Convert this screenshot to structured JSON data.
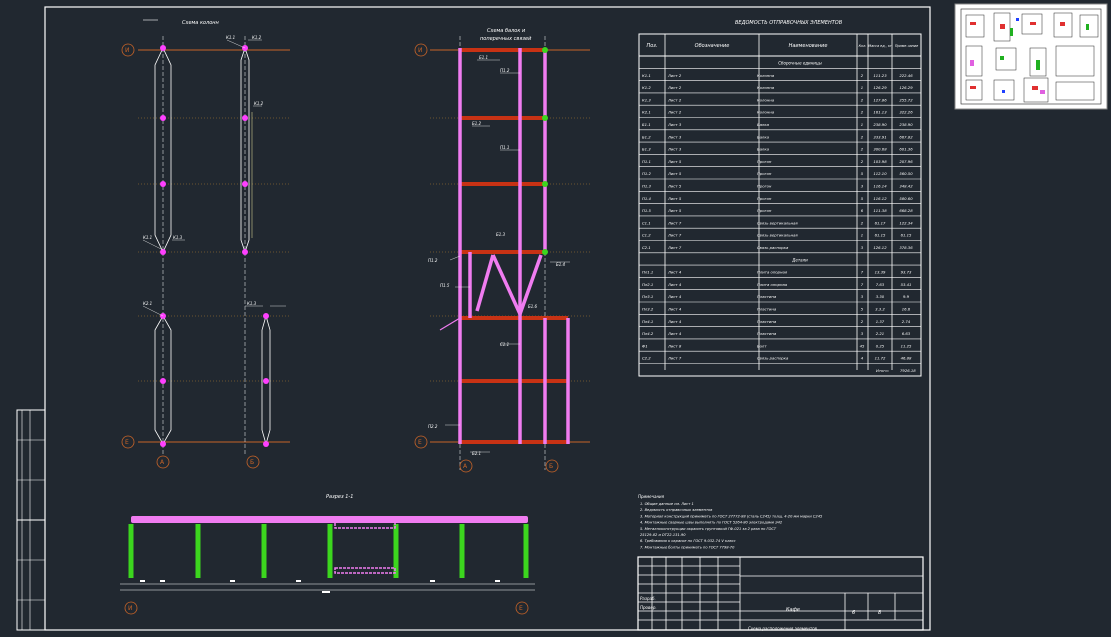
{
  "scheme_columns": {
    "title": "Схема колонн",
    "col_labels": [
      "К1.1",
      "К1.2",
      "К1.2",
      "К1.1",
      "К1.3",
      "К2.1",
      "К1.3"
    ]
  },
  "scheme_beams": {
    "title_line1": "Схема балок и",
    "title_line2": "поперечных связей",
    "beam_labels": [
      "Б1.1",
      "П1.2",
      "Б1.2",
      "П1.1",
      "Б1.3",
      "П1.2",
      "Б1.4",
      "П1.5",
      "Б1.6",
      "С1.1",
      "П2.2",
      "Б2.1"
    ]
  },
  "section": {
    "title": "Разрез 1-1"
  },
  "axes": {
    "top": "И",
    "bottom": "Е",
    "left": "А",
    "right": "Б"
  },
  "table": {
    "title": "ВЕДОМОСТЬ ОТПРАВОЧНЫХ ЭЛЕМЕНТОВ",
    "headers": [
      "Поз.",
      "Обозначение",
      "Наименование",
      "Кол.",
      "Масса ед., кг",
      "Приме-чание"
    ],
    "section1": "Сборочные единицы",
    "rows1": [
      [
        "К1.1",
        "Лист 2",
        "Колонна",
        "2",
        "111.23",
        "222.46"
      ],
      [
        "К1.2",
        "Лист 2",
        "Колонна",
        "1",
        "126.29",
        "126.29"
      ],
      [
        "К1.3",
        "Лист 2",
        "Колонна",
        "2",
        "127.86",
        "255.72"
      ],
      [
        "К2.1",
        "Лист 2",
        "Колонна",
        "2",
        "161.13",
        "322.26"
      ],
      [
        "Б1.1",
        "Лист 3",
        "Балка",
        "1",
        "238.90",
        "238.90"
      ],
      [
        "Б1.2",
        "Лист 3",
        "Балка",
        "2",
        "333.91",
        "667.82"
      ],
      [
        "Б1.3",
        "Лист 3",
        "Балка",
        "2",
        "300.68",
        "601.36"
      ],
      [
        "П1.1",
        "Лист 5",
        "Прогон",
        "2",
        "103.98",
        "207.96"
      ],
      [
        "П1.2",
        "Лист 5",
        "Прогон",
        "5",
        "112.10",
        "560.50"
      ],
      [
        "П1.3",
        "Лист 5",
        "Прогон",
        "3",
        "116.14",
        "348.42"
      ],
      [
        "П1.4",
        "Лист 5",
        "Прогон",
        "5",
        "116.12",
        "580.60"
      ],
      [
        "П1.5",
        "Лист 5",
        "Прогон",
        "6",
        "111.38",
        "668.28"
      ],
      [
        "С1.1",
        "Лист 7",
        "Связь вертикальная",
        "2",
        "61.17",
        "122.34"
      ],
      [
        "С1.2",
        "Лист 7",
        "Связь вертикальная",
        "1",
        "61.15",
        "61.15"
      ],
      [
        "С2.1",
        "Лист 7",
        "Связь распорка",
        "3",
        "126.12",
        "378.36"
      ]
    ],
    "section2": "Детали",
    "rows2": [
      [
        "Пл1.1",
        "Лист 4",
        "Плита опорная",
        "7",
        "13.39",
        "93.73"
      ],
      [
        "Пл2.1",
        "Лист 4",
        "Плита опорная",
        "7",
        "7.63",
        "53.41"
      ],
      [
        "Пл3.1",
        "Лист 4",
        "Пластина",
        "3",
        "3.30",
        "9.9"
      ],
      [
        "Пл3.2",
        "Лист 4",
        "Пластина",
        "5",
        "3.3.2",
        "16.6"
      ],
      [
        "Пл4.1",
        "Лист 4",
        "Пластина",
        "2",
        "1.37",
        "2.74"
      ],
      [
        "Пл4.2",
        "Лист 4",
        "Пластина",
        "3",
        "2.21",
        "6.63"
      ],
      [
        "Ф1",
        "Лист 8",
        "Болт",
        "45",
        "0.25",
        "11.25"
      ],
      [
        "С2.2",
        "Лист 7",
        "Связь распорка",
        "4",
        "11.72",
        "46.88"
      ]
    ],
    "total_label": "Итого:",
    "total_value": "7926.18"
  },
  "notes": {
    "title": "Примечания",
    "lines": [
      "1. Общие данные см. Лист 1",
      "2. Ведомость отправочных элементов",
      "3. Материал конструкций принимать по ГОСТ 27772-88 (сталь С245) толщ. 4-20 мм марки С245",
      "4. Монтажные сварные швы выполнять по ГОСТ 5264-80 электродами Э42",
      "5. Металлоконструкции окрасить грунтовкой ГФ-021 за 2 раза по ГОСТ",
      "   25129-82 и ОТ22-131-90",
      "6. Требования к окраске по ГОСТ 9.032-74 V класс",
      "7. Монтажные болты принимать по ГОСТ 7798-70"
    ]
  },
  "stamp": {
    "sheet_name": "Кафе",
    "drawing_name": "Схема расположения элементов",
    "sheet": "6",
    "sheets": "8",
    "roles": [
      "Разраб.",
      "Провер."
    ]
  },
  "colors": {
    "background": "#212830",
    "frame": "#ffffff",
    "beam_pink": "#f07cf0",
    "beam_red": "#c83214",
    "column_green": "#3cd61e",
    "axis": "#c86428"
  }
}
